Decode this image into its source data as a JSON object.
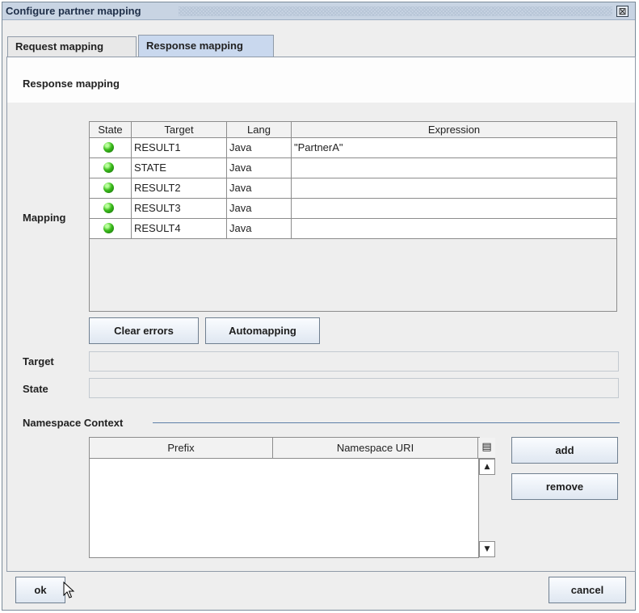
{
  "window": {
    "title": "Configure partner mapping",
    "close_glyph": "⊠"
  },
  "tabs": [
    {
      "label": "Request mapping",
      "selected": false
    },
    {
      "label": "Response mapping",
      "selected": true
    }
  ],
  "panel": {
    "title": "Response mapping"
  },
  "mapping": {
    "label": "Mapping",
    "columns": [
      "State",
      "Target",
      "Lang",
      "Expression"
    ],
    "rows": [
      {
        "state": "green-dot-icon",
        "target": "RESULT1",
        "lang": "Java",
        "expression": "\"PartnerA\""
      },
      {
        "state": "green-dot-icon",
        "target": "STATE",
        "lang": "Java",
        "expression": ""
      },
      {
        "state": "green-dot-icon",
        "target": "RESULT2",
        "lang": "Java",
        "expression": ""
      },
      {
        "state": "green-dot-icon",
        "target": "RESULT3",
        "lang": "Java",
        "expression": ""
      },
      {
        "state": "green-dot-icon",
        "target": "RESULT4",
        "lang": "Java",
        "expression": ""
      }
    ],
    "clear_errors_label": "Clear errors",
    "automapping_label": "Automapping"
  },
  "fields": {
    "target_label": "Target",
    "target_value": "",
    "state_label": "State",
    "state_value": ""
  },
  "namespace": {
    "label": "Namespace Context",
    "columns": [
      "Prefix",
      "Namespace URI"
    ],
    "add_label": "add",
    "remove_label": "remove"
  },
  "footer": {
    "ok_label": "ok",
    "cancel_label": "cancel"
  },
  "colors": {
    "accent": "#c9d8ee",
    "titlebar": "#c8d4e3",
    "status_ok": "#3cbc1c"
  }
}
